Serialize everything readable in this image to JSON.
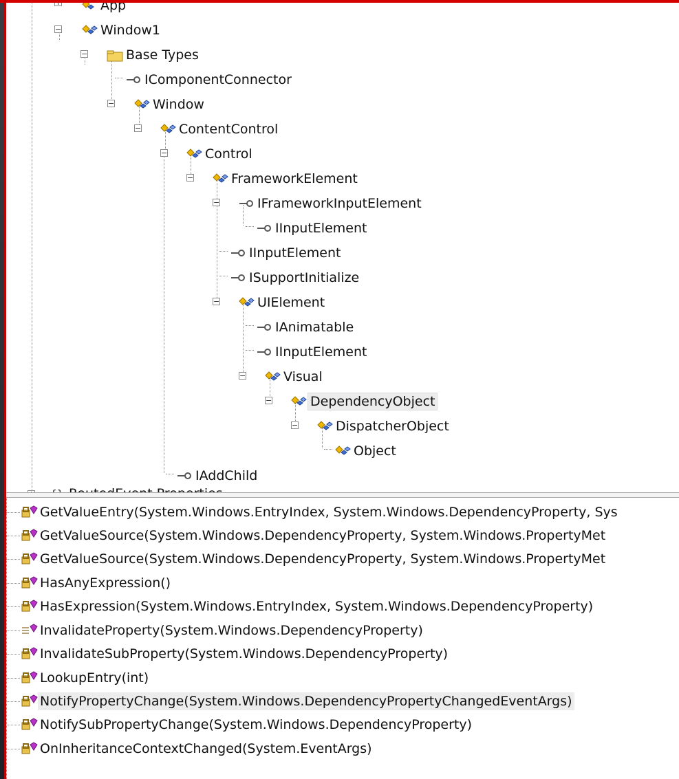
{
  "tree": {
    "nodes": [
      {
        "label": "App",
        "icon": "class-icon"
      },
      {
        "label": "Window1",
        "icon": "class-icon"
      },
      {
        "label": "Base Types",
        "icon": "folder-icon"
      },
      {
        "label": "IComponentConnector",
        "icon": "interface-icon"
      },
      {
        "label": "Window",
        "icon": "class-icon"
      },
      {
        "label": "ContentControl",
        "icon": "class-icon"
      },
      {
        "label": "Control",
        "icon": "class-icon"
      },
      {
        "label": "FrameworkElement",
        "icon": "class-icon"
      },
      {
        "label": "IFrameworkInputElement",
        "icon": "interface-icon"
      },
      {
        "label": "IInputElement",
        "icon": "interface-icon"
      },
      {
        "label": "IInputElement",
        "icon": "interface-icon"
      },
      {
        "label": "ISupportInitialize",
        "icon": "interface-icon"
      },
      {
        "label": "UIElement",
        "icon": "class-icon"
      },
      {
        "label": "IAnimatable",
        "icon": "interface-icon"
      },
      {
        "label": "IInputElement",
        "icon": "interface-icon"
      },
      {
        "label": "Visual",
        "icon": "class-icon"
      },
      {
        "label": "DependencyObject",
        "icon": "class-icon",
        "selected": true
      },
      {
        "label": "DispatcherObject",
        "icon": "class-icon"
      },
      {
        "label": "Object",
        "icon": "class-icon"
      },
      {
        "label": "IAddChild",
        "icon": "interface-icon"
      },
      {
        "label": "RoutedEvent Properties",
        "icon": "namespace-icon"
      }
    ]
  },
  "members": {
    "items": [
      {
        "label": "GetValueEntry(System.Windows.EntryIndex, System.Windows.DependencyProperty, Sys",
        "icon": "method-icon"
      },
      {
        "label": "GetValueSource(System.Windows.DependencyProperty, System.Windows.PropertyMet",
        "icon": "method-icon"
      },
      {
        "label": "GetValueSource(System.Windows.DependencyProperty, System.Windows.PropertyMet",
        "icon": "method-icon"
      },
      {
        "label": "HasAnyExpression()",
        "icon": "method-icon"
      },
      {
        "label": "HasExpression(System.Windows.EntryIndex, System.Windows.DependencyProperty)",
        "icon": "method-icon"
      },
      {
        "label": "InvalidateProperty(System.Windows.DependencyProperty)",
        "icon": "public-method-icon"
      },
      {
        "label": "InvalidateSubProperty(System.Windows.DependencyProperty)",
        "icon": "method-icon"
      },
      {
        "label": "LookupEntry(int)",
        "icon": "method-icon"
      },
      {
        "label": "NotifyPropertyChange(System.Windows.DependencyPropertyChangedEventArgs)",
        "icon": "method-icon",
        "highlighted": true
      },
      {
        "label": "NotifySubPropertyChange(System.Windows.DependencyProperty)",
        "icon": "method-icon"
      },
      {
        "label": "OnInheritanceContextChanged(System.EventArgs)",
        "icon": "method-icon"
      }
    ]
  },
  "colors": {
    "frame_red": "#d40000",
    "selection": "#ececec",
    "class_gold": "#f0b800",
    "class_blue": "#3d6fd6",
    "method_magenta": "#b832c8"
  }
}
